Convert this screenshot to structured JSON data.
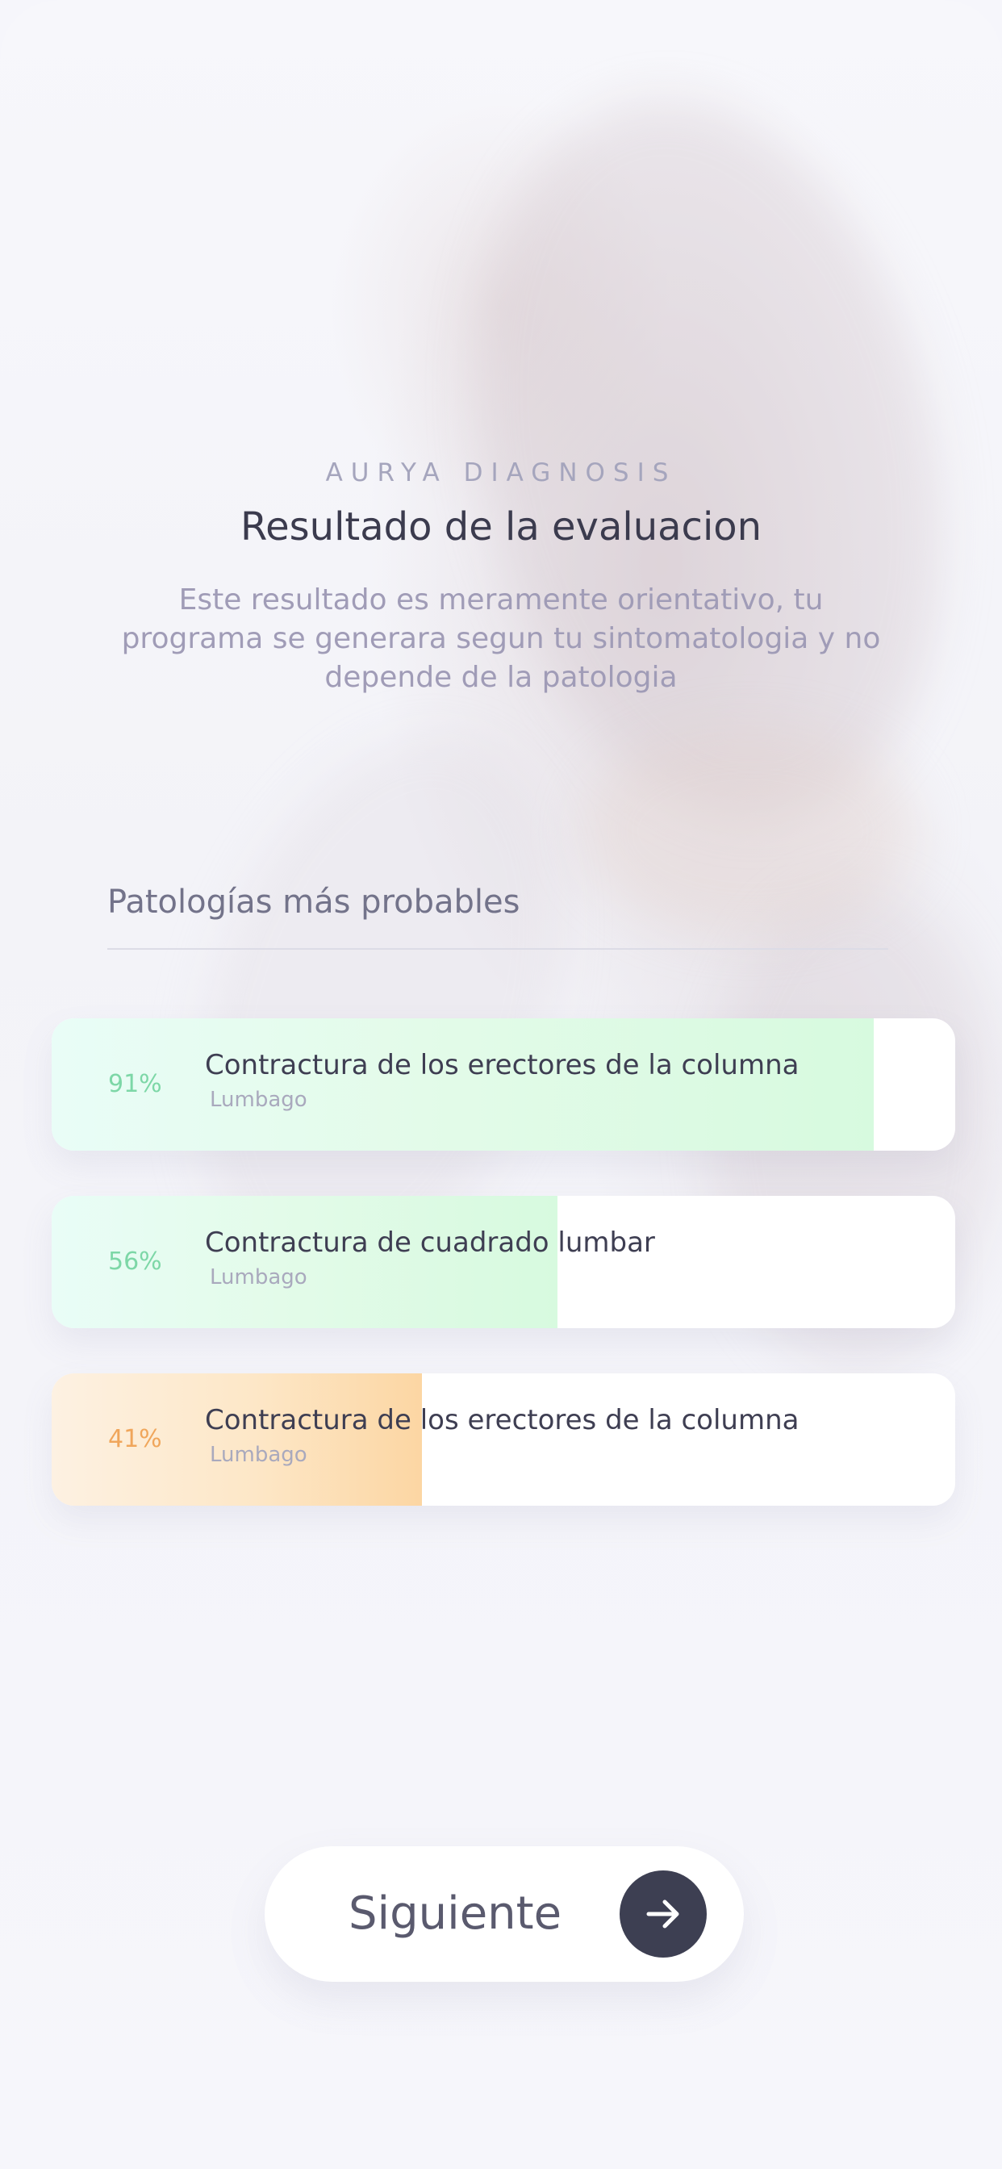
{
  "header": {
    "eyebrow": "AURYA DIAGNOSIS",
    "title": "Resultado de la evaluacion",
    "subtitle": "Este resultado es meramente orientativo, tu programa se generara segun tu sintomatologia y no depende de la patologia"
  },
  "section": {
    "label": "Patologías más probables"
  },
  "results": [
    {
      "percent_label": "91%",
      "fill_fraction": 0.91,
      "name": "Contractura de los erectores de la columna",
      "category": "Lumbago",
      "tone": "green",
      "color": "#7dd7a7"
    },
    {
      "percent_label": "56%",
      "fill_fraction": 0.56,
      "name": "Contractura de cuadrado lumbar",
      "category": "Lumbago",
      "tone": "green",
      "color": "#7dd7a7"
    },
    {
      "percent_label": "41%",
      "fill_fraction": 0.41,
      "name": "Contractura de los erectores de la columna",
      "category": "Lumbago",
      "tone": "orange",
      "color": "#f0a65b"
    }
  ],
  "footer": {
    "next_label": "Siguiente",
    "next_icon": "arrow-right-icon"
  },
  "colors": {
    "button_dark": "#3d3f52",
    "title_text": "#3b3b4e",
    "muted_text": "#a09cb7"
  }
}
